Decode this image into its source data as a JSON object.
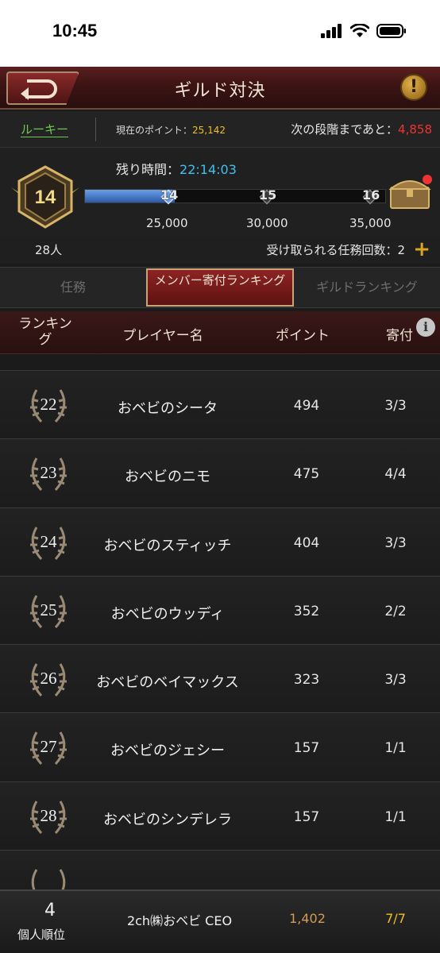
{
  "status_bar": {
    "time": "10:45"
  },
  "header": {
    "title": "ギルド対決"
  },
  "points": {
    "tier_label": "ルーキー",
    "current_label": "現在のポイント：",
    "current_value": "25,142",
    "next_label": "次の段階まであと：",
    "next_value": "4,858"
  },
  "progress": {
    "remain_label": "残り時間：",
    "remain_value": "22:14:03",
    "current_level": "14",
    "fill_fraction": 0.3,
    "milestones": [
      {
        "level": "14",
        "points": "25,000"
      },
      {
        "level": "15",
        "points": "30,000"
      },
      {
        "level": "16",
        "points": "35,000"
      }
    ]
  },
  "members": {
    "count": "28人",
    "receivable": "受け取られる任務回数：2"
  },
  "tabs": [
    {
      "label": "任務"
    },
    {
      "label": "メンバー寄付ランキング"
    },
    {
      "label": "ギルドランキング"
    }
  ],
  "table": {
    "headers": {
      "rank": "ランキング",
      "name": "プレイヤー名",
      "points": "ポイント",
      "donation": "寄付"
    },
    "rows": [
      {
        "rank": "22",
        "name": "おベビのシータ",
        "points": "494",
        "donation": "3/3"
      },
      {
        "rank": "23",
        "name": "おベビのニモ",
        "points": "475",
        "donation": "4/4"
      },
      {
        "rank": "24",
        "name": "おベビのスティッチ",
        "points": "404",
        "donation": "3/3"
      },
      {
        "rank": "25",
        "name": "おベビのウッディ",
        "points": "352",
        "donation": "2/2"
      },
      {
        "rank": "26",
        "name": "おベビのベイマックス",
        "points": "323",
        "donation": "3/3"
      },
      {
        "rank": "27",
        "name": "おベビのジェシー",
        "points": "157",
        "donation": "1/1"
      },
      {
        "rank": "28",
        "name": "おベビのシンデレラ",
        "points": "157",
        "donation": "1/1"
      }
    ]
  },
  "footer": {
    "rank": "4",
    "rank_label": "個人順位",
    "name": "2ch㈱おベビ CEO",
    "points": "1,402",
    "donation": "7/7"
  }
}
